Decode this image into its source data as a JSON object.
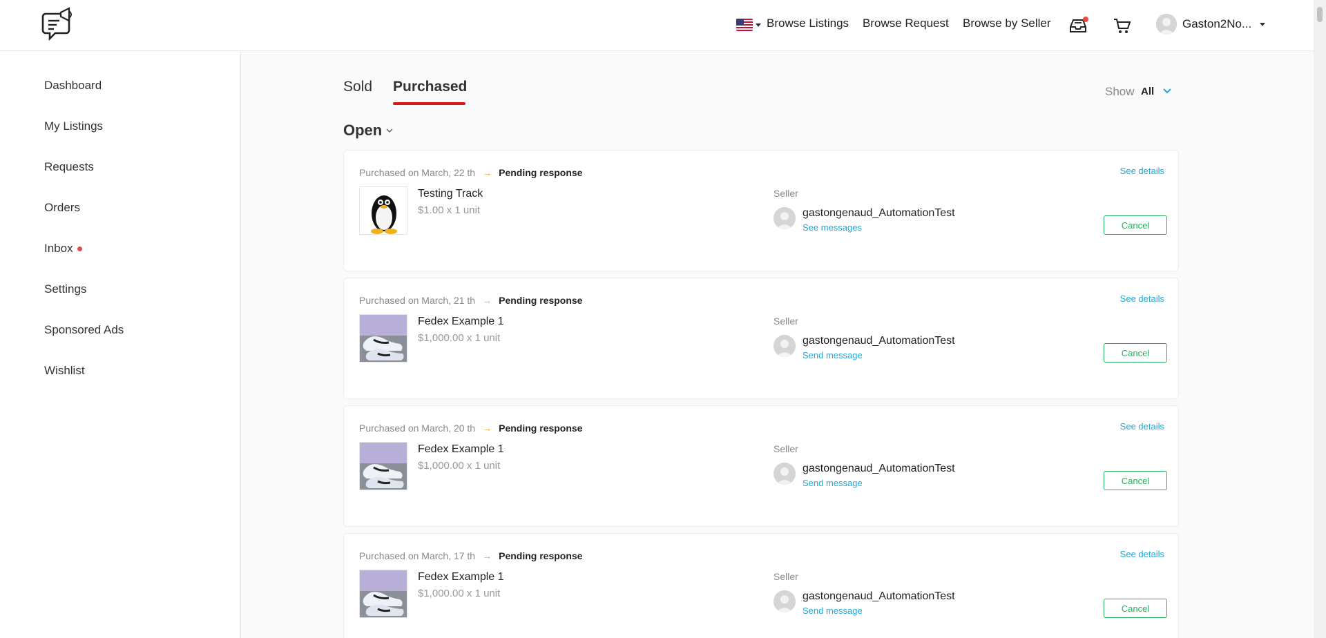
{
  "header": {
    "nav": {
      "browse_listings": "Browse Listings",
      "browse_request": "Browse Request",
      "browse_by_seller": "Browse by Seller"
    },
    "user_name": "Gaston2No...",
    "icons": [
      "logo-icon",
      "us-flag-icon",
      "inbox-tray-icon",
      "cart-icon",
      "avatar"
    ]
  },
  "sidebar": {
    "items": [
      {
        "label": "Dashboard"
      },
      {
        "label": "My Listings"
      },
      {
        "label": "Requests"
      },
      {
        "label": "Orders"
      },
      {
        "label": "Inbox",
        "has_dot": true
      },
      {
        "label": "Settings"
      },
      {
        "label": "Sponsored Ads"
      },
      {
        "label": "Wishlist"
      }
    ]
  },
  "main": {
    "tabs": [
      {
        "label": "Sold",
        "active": false
      },
      {
        "label": "Purchased",
        "active": true
      }
    ],
    "show_label": "Show",
    "show_value": "All",
    "section_title": "Open"
  },
  "orders": [
    {
      "meta": "Purchased on March, 22 th",
      "status": "Pending response",
      "title": "Testing Track",
      "price": "$1.00 x 1 unit",
      "seller_label": "Seller",
      "seller_name": "gastongenaud_AutomationTest",
      "seller_link": "See messages",
      "details": "See details",
      "cancel": "Cancel",
      "thumb": "penguin"
    },
    {
      "meta": "Purchased on March, 21 th",
      "status": "Pending response",
      "title": "Fedex Example 1",
      "price": "$1,000.00 x 1 unit",
      "seller_label": "Seller",
      "seller_name": "gastongenaud_AutomationTest",
      "seller_link": "Send message",
      "details": "See details",
      "cancel": "Cancel",
      "thumb": "shoes"
    },
    {
      "meta": "Purchased on March, 20 th",
      "status": "Pending response",
      "title": "Fedex Example 1",
      "price": "$1,000.00 x 1 unit",
      "seller_label": "Seller",
      "seller_name": "gastongenaud_AutomationTest",
      "seller_link": "Send message",
      "details": "See details",
      "cancel": "Cancel",
      "thumb": "shoes"
    },
    {
      "meta": "Purchased on March, 17 th",
      "status": "Pending response",
      "title": "Fedex Example 1",
      "price": "$1,000.00 x 1 unit",
      "seller_label": "Seller",
      "seller_name": "gastongenaud_AutomationTest",
      "seller_link": "Send message",
      "details": "See details",
      "cancel": "Cancel",
      "thumb": "shoes"
    }
  ],
  "colors": {
    "accent_red": "#d41a1a",
    "link_blue": "#20a8d8",
    "cancel_green": "#27ae60",
    "arrow_orange": "#f5a623"
  }
}
